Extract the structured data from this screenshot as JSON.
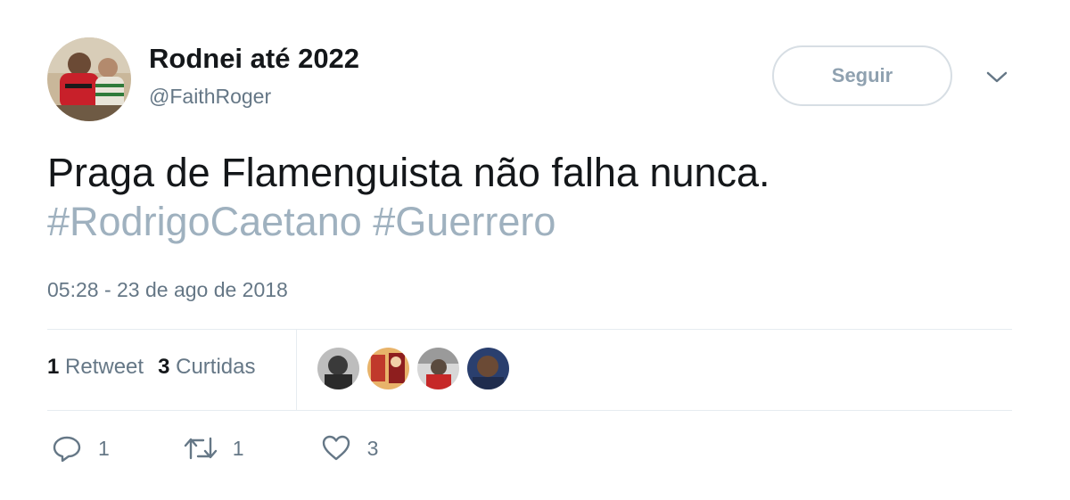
{
  "tweet": {
    "display_name": "Rodnei até 2022",
    "handle": "@FaithRoger",
    "text": "Praga de Flamenguista não falha nunca.",
    "hashtags": [
      "#RodrigoCaetano",
      "#Guerrero"
    ],
    "timestamp": "05:28 - 23 de ago de 2018",
    "follow_label": "Seguir"
  },
  "stats": {
    "retweets_count": "1",
    "retweets_label": "Retweet",
    "likes_count": "3",
    "likes_label": "Curtidas"
  },
  "actions": {
    "reply_count": "1",
    "retweet_count": "1",
    "like_count": "3"
  },
  "icons": [
    "reply-icon",
    "retweet-icon",
    "heart-icon",
    "chevron-down-icon"
  ],
  "colors": {
    "text": "#14171a",
    "secondary": "#657786",
    "hashtag": "#9fb1bf",
    "border": "#e6ecf0"
  }
}
